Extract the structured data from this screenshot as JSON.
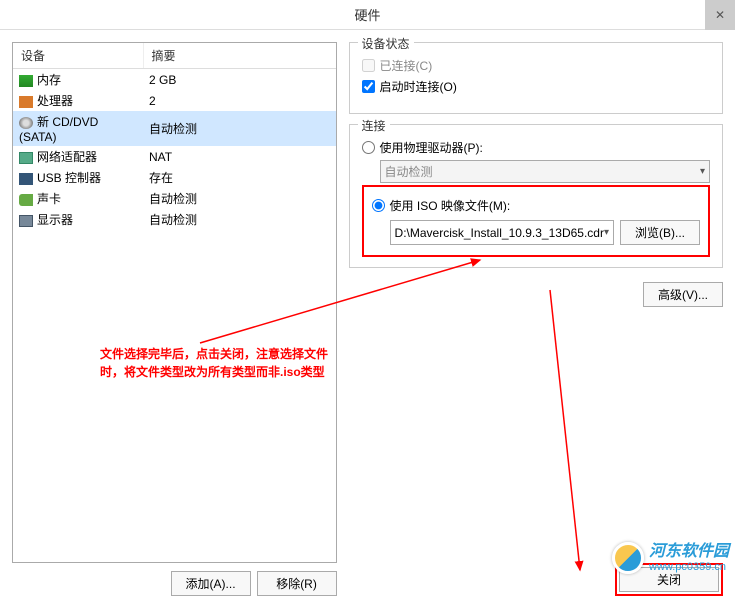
{
  "window_title": "硬件",
  "table": {
    "headers": {
      "device": "设备",
      "summary": "摘要"
    },
    "rows": [
      {
        "icon": "memory",
        "name": "内存",
        "summary": "2 GB",
        "selected": false
      },
      {
        "icon": "cpu",
        "name": "处理器",
        "summary": "2",
        "selected": false
      },
      {
        "icon": "cd",
        "name": "新 CD/DVD (SATA)",
        "summary": "自动检测",
        "selected": true
      },
      {
        "icon": "net",
        "name": "网络适配器",
        "summary": "NAT",
        "selected": false
      },
      {
        "icon": "usb",
        "name": "USB 控制器",
        "summary": "存在",
        "selected": false
      },
      {
        "icon": "sound",
        "name": "声卡",
        "summary": "自动检测",
        "selected": false
      },
      {
        "icon": "display",
        "name": "显示器",
        "summary": "自动检测",
        "selected": false
      }
    ]
  },
  "buttons": {
    "add": "添加(A)...",
    "remove": "移除(R)",
    "browse": "浏览(B)...",
    "advanced": "高级(V)...",
    "close": "关闭"
  },
  "device_state": {
    "title": "设备状态",
    "connected": "已连接(C)",
    "connected_checked": false,
    "connected_disabled": true,
    "connect_at_poweron": "启动时连接(O)",
    "connect_at_poweron_checked": true
  },
  "connection": {
    "title": "连接",
    "physical": "使用物理驱动器(P):",
    "physical_selected": false,
    "auto_detect": "自动检测",
    "iso": "使用 ISO 映像文件(M):",
    "iso_selected": true,
    "iso_path": "D:\\Mavercisk_Install_10.9.3_13D65.cdr"
  },
  "annotation": {
    "line1": "文件选择完毕后，点击关闭，注意选择文件",
    "line2": "时，将文件类型改为所有类型而非.iso类型"
  },
  "watermark": {
    "title": "河东软件园",
    "url": "www.pc0359.cn"
  }
}
